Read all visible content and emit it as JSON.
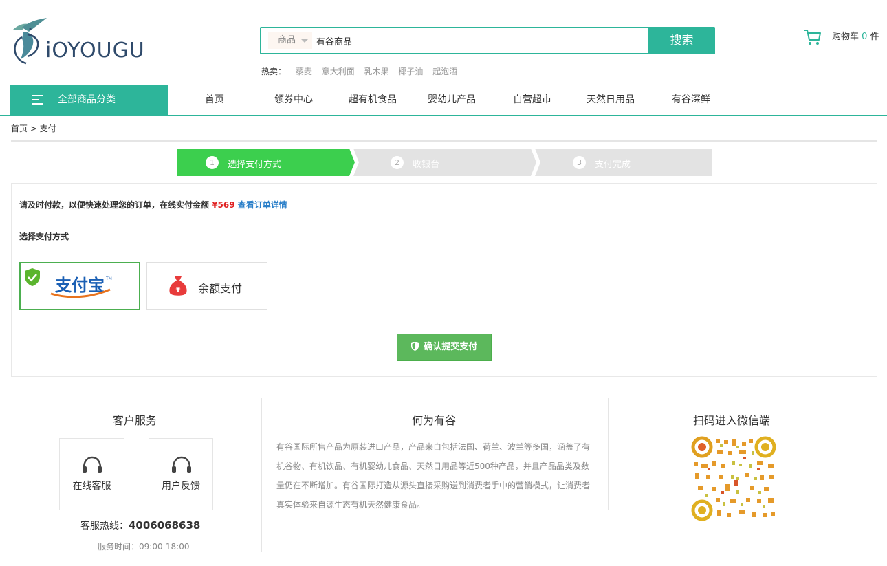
{
  "brand": {
    "logo_text": "iOYOUGU"
  },
  "search": {
    "category": "商品",
    "value": "有谷商品",
    "button": "搜索",
    "hot_label": "热卖：",
    "hot_items": [
      "藜麦",
      "意大利面",
      "乳木果",
      "椰子油",
      "起泡酒"
    ]
  },
  "cart": {
    "label": "购物车",
    "count": "0",
    "unit": "件"
  },
  "nav": {
    "all_categories": "全部商品分类",
    "items": [
      "首页",
      "领券中心",
      "超有机食品",
      "婴幼儿产品",
      "自营超市",
      "天然日用品",
      "有谷深鲜"
    ]
  },
  "breadcrumb": {
    "home": "首页",
    "sep": ">",
    "current": "支付"
  },
  "steps": [
    {
      "num": "1",
      "label": "选择支付方式",
      "active": true
    },
    {
      "num": "2",
      "label": "收银台",
      "active": false
    },
    {
      "num": "3",
      "label": "支付完成",
      "active": false
    }
  ],
  "payment": {
    "notice_text": "请及时付款，以便快速处理您的订单，在线实付金额",
    "amount": "¥569",
    "detail_link": "查看订单详情",
    "method_title": "选择支付方式",
    "alipay_label": "支付宝",
    "balance_label": "余额支付",
    "confirm_button": "确认提交支付"
  },
  "footer": {
    "service_title": "客户服务",
    "online_service": "在线客服",
    "feedback": "用户反馈",
    "hotline_label": "客服热线：",
    "hotline_number": "4006068638",
    "service_time": "服务时间：09:00-18:00",
    "about_title": "何为有谷",
    "about_text": "有谷国际所售产品为原装进口产品，产品来自包括法国、荷兰、波兰等多国，涵盖了有机谷物、有机饮品、有机婴幼儿食品、天然日用品等近500种产品，并且产品品类及数量仍在不断增加。有谷国际打造从源头直接采购送到消费者手中的营销模式，让消费者真实体验来自源生态有机天然健康食品。",
    "qr_title": "扫码进入微信端"
  },
  "colors": {
    "brand_green": "#2db59a",
    "step_green": "#3ccf4e",
    "price_red": "#e02020",
    "link_blue": "#2a7fc9",
    "confirm_green": "#5cb85c"
  }
}
